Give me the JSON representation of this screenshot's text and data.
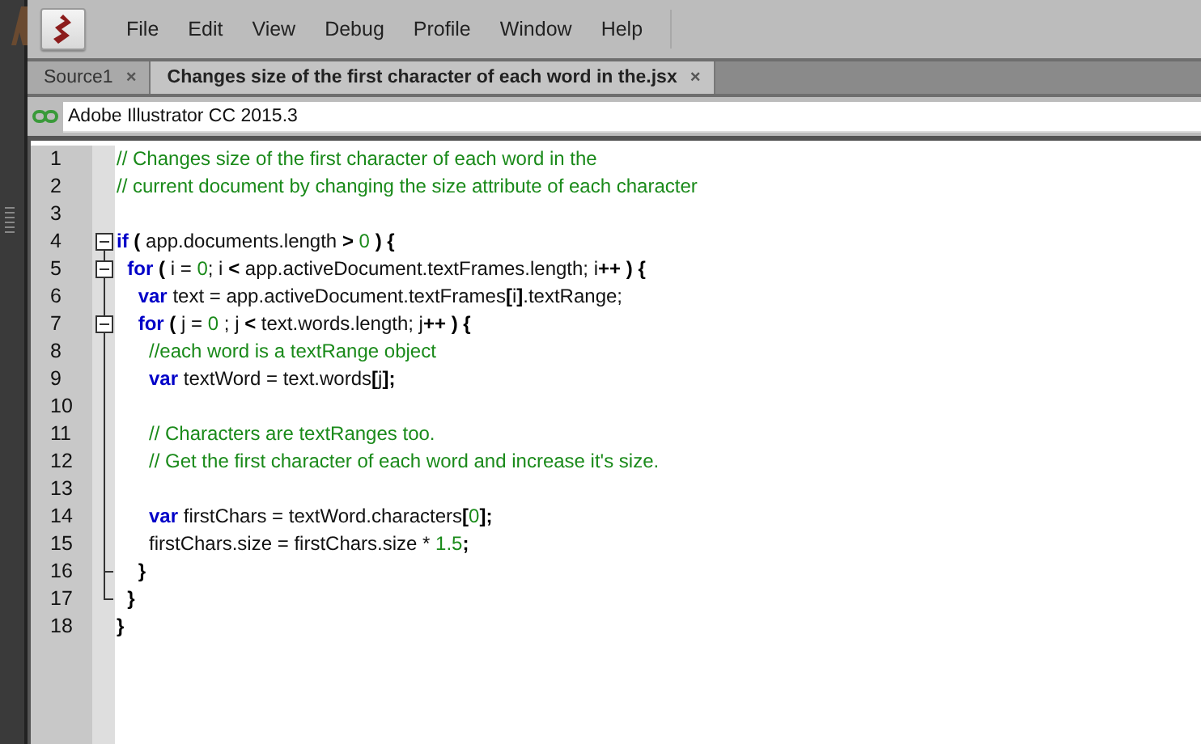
{
  "menu": [
    "File",
    "Edit",
    "View",
    "Debug",
    "Profile",
    "Window",
    "Help"
  ],
  "tabs": [
    {
      "label": "Source1",
      "close": "×",
      "selected": false
    },
    {
      "label": "Changes size of the first character of each word in the.jsx",
      "close": "×",
      "selected": true
    }
  ],
  "target": {
    "value": "Adobe Illustrator CC 2015.3"
  },
  "code": [
    {
      "number": "1",
      "kind": "plain",
      "tokens": [
        {
          "kind": "comment",
          "text": "// Changes size of the first character of each word in the"
        }
      ]
    },
    {
      "number": "2",
      "kind": "plain",
      "tokens": [
        {
          "kind": "comment",
          "text": "// current document by changing the size attribute of each character"
        }
      ]
    },
    {
      "number": "3",
      "kind": "plain"
    },
    {
      "number": "4",
      "kind": "fold-start",
      "tokens": [
        {
          "kind": "keyword",
          "text": "if"
        },
        {
          "kind": "punct",
          "text": " ("
        },
        {
          "kind": "plain",
          "text": " app.documents.length "
        },
        {
          "kind": "punct",
          "text": ">"
        },
        {
          "kind": "number",
          "text": " 0"
        },
        {
          "kind": "punct",
          "text": " ) {"
        }
      ]
    },
    {
      "number": "5",
      "kind": "fold-nested",
      "tokens": [
        {
          "kind": "keyword",
          "text": "  for"
        },
        {
          "kind": "punct",
          "text": " ("
        },
        {
          "kind": "plain",
          "text": " i = "
        },
        {
          "kind": "number",
          "text": "0"
        },
        {
          "kind": "plain",
          "text": "; i "
        },
        {
          "kind": "punct",
          "text": "<"
        },
        {
          "kind": "plain",
          "text": " app.activeDocument.textFrames.length; i"
        },
        {
          "kind": "punct",
          "text": "++ ) {"
        }
      ]
    },
    {
      "number": "6",
      "kind": "fold-body",
      "tokens": [
        {
          "kind": "keyword",
          "text": "    var"
        },
        {
          "kind": "plain",
          "text": " text = app.activeDocument.textFrames"
        },
        {
          "kind": "punct",
          "text": "["
        },
        {
          "kind": "plain",
          "text": "i"
        },
        {
          "kind": "punct",
          "text": "]"
        },
        {
          "kind": "plain",
          "text": ".textRange;"
        }
      ]
    },
    {
      "number": "7",
      "kind": "fold-nested",
      "tokens": [
        {
          "kind": "keyword",
          "text": "    for"
        },
        {
          "kind": "punct",
          "text": " ("
        },
        {
          "kind": "plain",
          "text": " j = "
        },
        {
          "kind": "number",
          "text": "0"
        },
        {
          "kind": "plain",
          "text": " ; j "
        },
        {
          "kind": "punct",
          "text": "<"
        },
        {
          "kind": "plain",
          "text": " text.words.length; j"
        },
        {
          "kind": "punct",
          "text": "++ ) {"
        }
      ]
    },
    {
      "number": "8",
      "kind": "fold-body",
      "tokens": [
        {
          "kind": "comment",
          "text": "      //each word is a textRange object"
        }
      ]
    },
    {
      "number": "9",
      "kind": "fold-body",
      "tokens": [
        {
          "kind": "keyword",
          "text": "      var"
        },
        {
          "kind": "plain",
          "text": " textWord = text.words"
        },
        {
          "kind": "punct",
          "text": "["
        },
        {
          "kind": "plain",
          "text": "j"
        },
        {
          "kind": "punct",
          "text": "];"
        }
      ]
    },
    {
      "number": "10",
      "kind": "fold-body"
    },
    {
      "number": "11",
      "kind": "fold-body",
      "tokens": [
        {
          "kind": "comment",
          "text": "      // Characters are textRanges too."
        }
      ]
    },
    {
      "number": "12",
      "kind": "fold-body",
      "tokens": [
        {
          "kind": "comment",
          "text": "      // Get the first character of each word and increase it's size."
        }
      ]
    },
    {
      "number": "13",
      "kind": "fold-body"
    },
    {
      "number": "14",
      "kind": "fold-body",
      "tokens": [
        {
          "kind": "keyword",
          "text": "      var"
        },
        {
          "kind": "plain",
          "text": " firstChars = textWord.characters"
        },
        {
          "kind": "punct",
          "text": "["
        },
        {
          "kind": "number",
          "text": "0"
        },
        {
          "kind": "punct",
          "text": "];"
        }
      ]
    },
    {
      "number": "15",
      "kind": "fold-body",
      "tokens": [
        {
          "kind": "plain",
          "text": "      firstChars.size = firstChars.size * "
        },
        {
          "kind": "number",
          "text": "1.5"
        },
        {
          "kind": "punct",
          "text": ";"
        }
      ]
    },
    {
      "number": "16",
      "kind": "fold-inner-end",
      "tokens": [
        {
          "kind": "punct",
          "text": "    }"
        }
      ]
    },
    {
      "number": "17",
      "kind": "fold-end",
      "tokens": [
        {
          "kind": "punct",
          "text": "  }"
        }
      ]
    },
    {
      "number": "18",
      "kind": "plain",
      "tokens": [
        {
          "kind": "punct",
          "text": "}"
        }
      ]
    }
  ]
}
